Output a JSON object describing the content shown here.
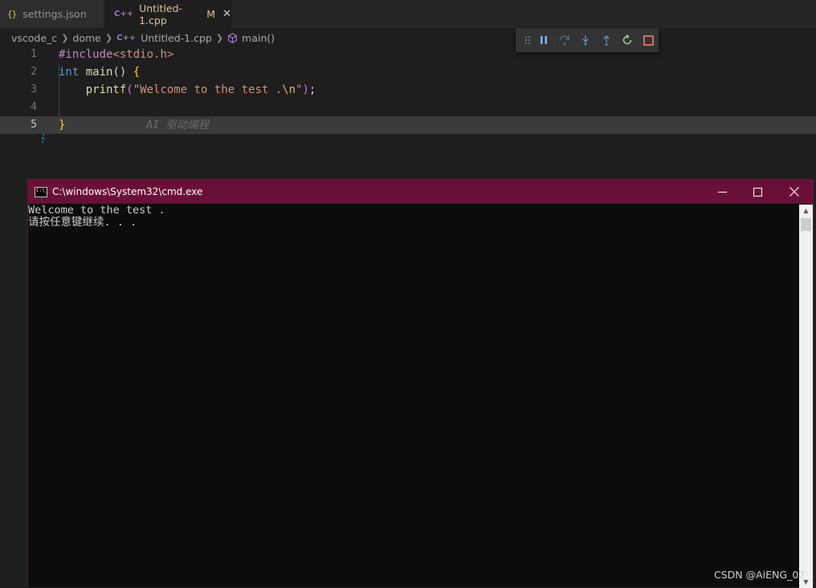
{
  "tabs": [
    {
      "label": "settings.json",
      "icon": "json-icon",
      "icon_text": "{}"
    },
    {
      "label": "Untitled-1.cpp",
      "icon": "cpp-icon",
      "icon_text": "C++",
      "modified": "M"
    }
  ],
  "breadcrumb": {
    "items": [
      "vscode_c",
      "dome",
      "Untitled-1.cpp",
      "main()"
    ]
  },
  "debug_toolbar": {
    "buttons": [
      "pause-icon",
      "step-over-icon",
      "step-into-icon",
      "step-out-icon",
      "restart-icon",
      "stop-icon"
    ]
  },
  "editor": {
    "lines": [
      {
        "num": "1",
        "tokens": [
          [
            "#include",
            "pre"
          ],
          [
            "<stdio.h>",
            "str"
          ]
        ]
      },
      {
        "num": "2",
        "tokens": [
          [
            "int ",
            "kw"
          ],
          [
            "main",
            "fn"
          ],
          [
            "() ",
            "plain"
          ],
          [
            "{",
            "brace"
          ]
        ]
      },
      {
        "num": "3",
        "tokens": [
          [
            "    printf",
            "fn"
          ],
          [
            "(",
            "paren"
          ],
          [
            "\"Welcome to the test .",
            "str"
          ],
          [
            "\\n",
            "esc"
          ],
          [
            "\"",
            "str"
          ],
          [
            ")",
            "paren"
          ],
          [
            ";",
            "plain"
          ]
        ]
      },
      {
        "num": "4",
        "tokens": []
      },
      {
        "num": "5",
        "tokens": [
          [
            "}",
            "brace"
          ]
        ]
      }
    ],
    "ghost_text": "AI 驱动编程"
  },
  "cmd_window": {
    "title": "C:\\windows\\System32\\cmd.exe",
    "icon_text": "C:\\_",
    "output": [
      "Welcome to the test .",
      "请按任意键继续. . ."
    ]
  },
  "watermark": "CSDN @AiENG_07",
  "colors": {
    "cmd_title_bg": "#6a1036",
    "editor_bg": "#1e1e1e",
    "tab_active_fg": "#e2c08d",
    "debug_stop": "#f48771",
    "debug_restart": "#89d185",
    "debug_step": "#75beff"
  }
}
